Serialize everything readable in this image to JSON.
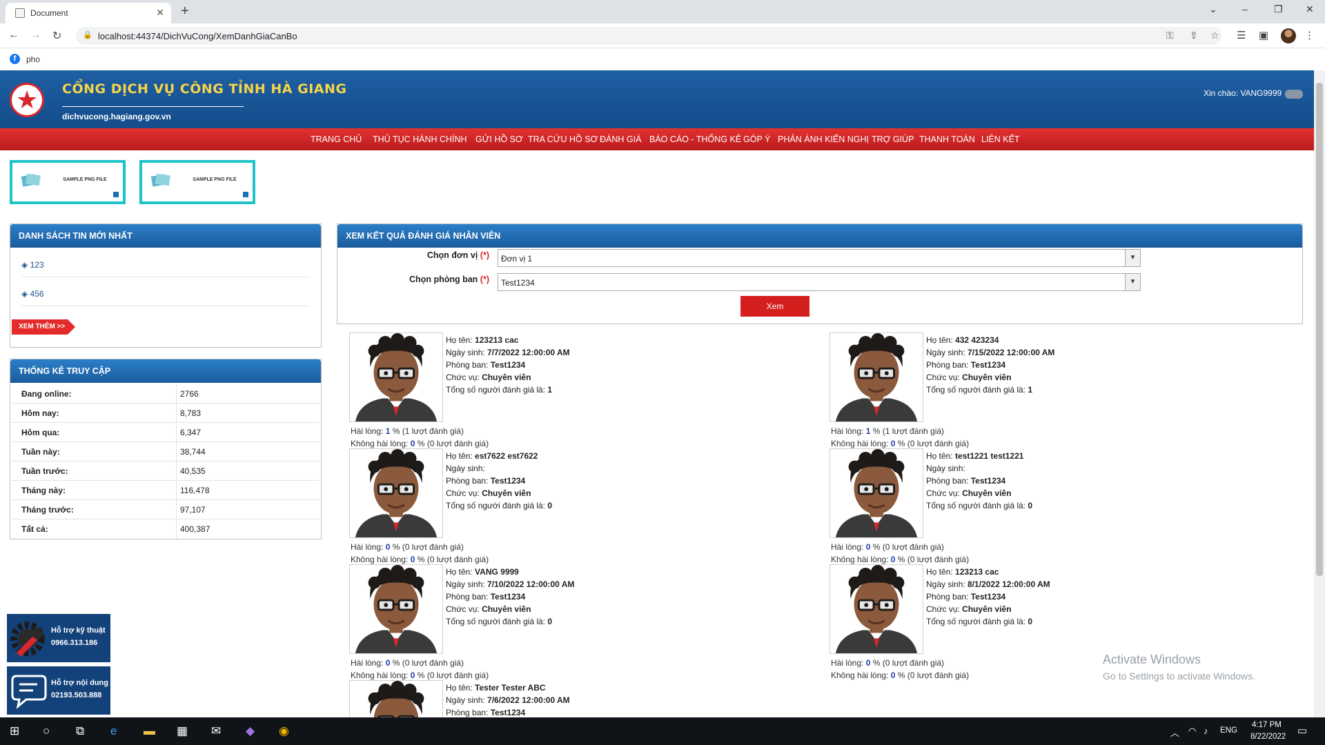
{
  "browser": {
    "tab_title": "Document",
    "new_tab": "+",
    "url": "localhost:44374/DichVuCong/XemDanhGiaCanBo",
    "bookmark": "pho"
  },
  "header": {
    "title": "CỔNG DỊCH VỤ CÔNG TỈNH HÀ GIANG",
    "domain": "dichvucong.hagiang.gov.vn",
    "greeting": "Xin chào: VANG9999"
  },
  "nav": [
    "TRANG CHỦ",
    "THỦ TỤC HÀNH CHÍNH",
    "GỬI HỒ SƠ",
    "TRA CỨU HỒ SƠ",
    "ĐÁNH GIÁ",
    "BÁO CÁO - THỐNG KÊ",
    "GÓP Ý",
    "PHẢN ÁNH KIẾN NGHỊ",
    "TRỢ GIÚP",
    "THANH TOÁN",
    "LIÊN KẾT"
  ],
  "banners": [
    {
      "text": "SAMPLE PNG FILE"
    },
    {
      "text": "SAMPLE PNG FILE"
    }
  ],
  "news": {
    "title": "DANH SÁCH TIN MỚI NHẤT",
    "items": [
      "123",
      "456"
    ],
    "more": "XEM THÊM >>"
  },
  "stats": {
    "title": "THỐNG KÊ TRUY CẬP",
    "rows": [
      {
        "k": "Đang online:",
        "v": "2766"
      },
      {
        "k": "Hôm nay:",
        "v": "8,783"
      },
      {
        "k": "Hôm qua:",
        "v": "6,347"
      },
      {
        "k": "Tuần này:",
        "v": "38,744"
      },
      {
        "k": "Tuần trước:",
        "v": "40,535"
      },
      {
        "k": "Tháng này:",
        "v": "116,478"
      },
      {
        "k": "Tháng trước:",
        "v": "97,107"
      },
      {
        "k": "Tất cả:",
        "v": "400,387"
      }
    ]
  },
  "form": {
    "title": "XEM KẾT QUẢ ĐÁNH GIÁ NHÂN VIÊN",
    "unit_label": "Chọn đơn vị",
    "unit_value": "Đơn vị 1",
    "dept_label": "Chọn phòng ban",
    "dept_value": "Test1234",
    "required": "(*)",
    "submit": "Xem"
  },
  "labels": {
    "name": "Họ tên:",
    "dob": "Ngày sinh:",
    "dept": "Phòng ban:",
    "position": "Chức vụ:",
    "total": "Tổng số người đánh giá là:",
    "satisfied": "Hài lòng:",
    "unsatisfied": "Không hài lòng:"
  },
  "employees": [
    {
      "name": "123213 cac",
      "dob": "7/7/2022 12:00:00 AM",
      "dept": "Test1234",
      "position": "Chuyên viên",
      "total": "1",
      "sat_pct": "1",
      "sat_txt": "% (1 lượt đánh giá)",
      "uns_pct": "0",
      "uns_txt": "% (0 lượt đánh giá)"
    },
    {
      "name": "432 423234",
      "dob": "7/15/2022 12:00:00 AM",
      "dept": "Test1234",
      "position": "Chuyên viên",
      "total": "1",
      "sat_pct": "1",
      "sat_txt": "% (1 lượt đánh giá)",
      "uns_pct": "0",
      "uns_txt": "% (0 lượt đánh giá)"
    },
    {
      "name": "est7622 est7622",
      "dob": "",
      "dept": "Test1234",
      "position": "Chuyên viên",
      "total": "0",
      "sat_pct": "0",
      "sat_txt": "% (0 lượt đánh giá)",
      "uns_pct": "0",
      "uns_txt": "% (0 lượt đánh giá)"
    },
    {
      "name": "test1221 test1221",
      "dob": "",
      "dept": "Test1234",
      "position": "Chuyên viên",
      "total": "0",
      "sat_pct": "0",
      "sat_txt": "% (0 lượt đánh giá)",
      "uns_pct": "0",
      "uns_txt": "% (0 lượt đánh giá)"
    },
    {
      "name": "VANG 9999",
      "dob": "7/10/2022 12:00:00 AM",
      "dept": "Test1234",
      "position": "Chuyên viên",
      "total": "0",
      "sat_pct": "0",
      "sat_txt": "% (0 lượt đánh giá)",
      "uns_pct": "0",
      "uns_txt": "% (0 lượt đánh giá)"
    },
    {
      "name": "123213 cac",
      "dob": "8/1/2022 12:00:00 AM",
      "dept": "Test1234",
      "position": "Chuyên viên",
      "total": "0",
      "sat_pct": "0",
      "sat_txt": "% (0 lượt đánh giá)",
      "uns_pct": "0",
      "uns_txt": "% (0 lượt đánh giá)"
    },
    {
      "name": "Tester Tester ABC",
      "dob": "7/6/2022 12:00:00 AM",
      "dept": "Test1234"
    }
  ],
  "support": [
    {
      "line1": "Hỗ trợ kỹ thuật",
      "line2": "0966.313.186"
    },
    {
      "line1": "Hỗ trợ nội dung",
      "line2": "02193.503.888"
    }
  ],
  "watermark": {
    "line1": "Activate Windows",
    "line2": "Go to Settings to activate Windows."
  },
  "taskbar": {
    "lang": "ENG",
    "time": "4:17 PM",
    "date": "8/22/2022"
  }
}
